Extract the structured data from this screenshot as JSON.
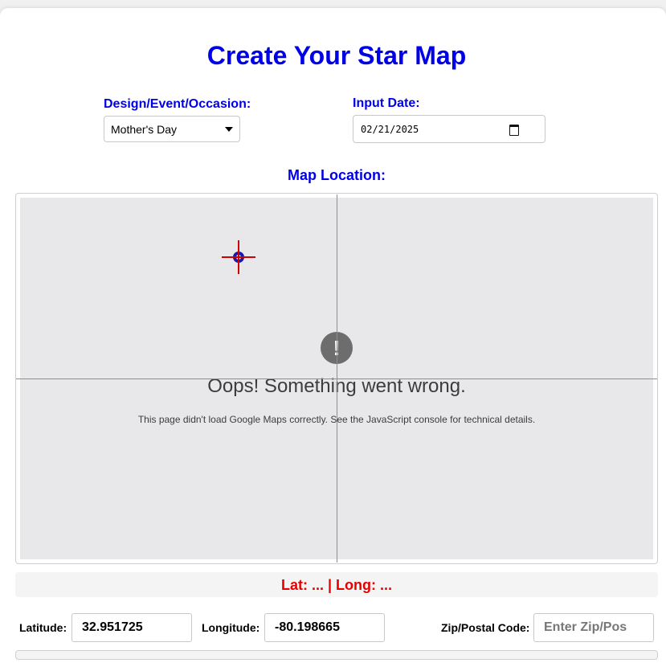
{
  "page": {
    "title": "Create Your Star Map"
  },
  "design": {
    "label": "Design/Event/Occasion:",
    "selected": "Mother's Day"
  },
  "date": {
    "label": "Input Date:",
    "value": "02/21/2025"
  },
  "map": {
    "label": "Map Location:",
    "error_title": "Oops! Something went wrong.",
    "error_detail": "This page didn't load Google Maps correctly. See the JavaScript console for technical details.",
    "error_icon": "!"
  },
  "coords_display": "Lat: ... | Long: ...",
  "latitude": {
    "label": "Latitude:",
    "value": "32.951725"
  },
  "longitude": {
    "label": "Longitude:",
    "value": "-80.198665"
  },
  "zip": {
    "label": "Zip/Postal Code:",
    "placeholder": "Enter Zip/Pos"
  },
  "colors": {
    "heading": "#0000e6",
    "coords": "#e60000",
    "crosshair": "#e06b6b"
  },
  "icons": [
    "chevron-down-icon",
    "calendar-icon",
    "crosshair-marker-icon",
    "error-icon"
  ]
}
